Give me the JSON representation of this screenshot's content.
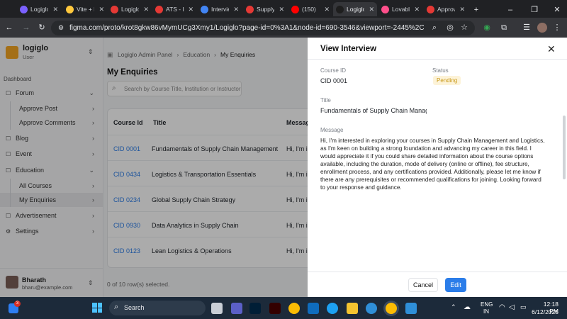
{
  "browser": {
    "tabs": [
      {
        "label": "Logiglo",
        "color": "#7b61ff"
      },
      {
        "label": "Vite + React",
        "color": "#ffc83d"
      },
      {
        "label": "Logiglo",
        "color": "#e53935"
      },
      {
        "label": "ATS - Logiglo",
        "color": "#e53935"
      },
      {
        "label": "Interview",
        "color": "#4285f4"
      },
      {
        "label": "Supply Chain",
        "color": "#e53935"
      },
      {
        "label": "(150)",
        "color": "#ff0000"
      },
      {
        "label": "Logiglo",
        "color": "#1e1e1e"
      },
      {
        "label": "Lovable",
        "color": "#ff4f8b"
      },
      {
        "label": "Approve",
        "color": "#e53935"
      }
    ],
    "url": "figma.com/proto/krot8gkw86vMymUCg3Xmy1/Logiglo?page-id=0%3A1&node-id=690-3546&viewport=-2445%2C-5346%2C0..."
  },
  "sidebar": {
    "brand": "logiglo",
    "brand_sub": "User",
    "section": "Dashboard",
    "items": [
      {
        "label": "Forum",
        "chev": "⌄"
      },
      {
        "label": "Approve Post",
        "chev": "›"
      },
      {
        "label": "Approve Comments",
        "chev": "›"
      },
      {
        "label": "Blog",
        "chev": "›"
      },
      {
        "label": "Event",
        "chev": "›"
      },
      {
        "label": "Education",
        "chev": "⌄"
      },
      {
        "label": "All Courses",
        "chev": "›"
      },
      {
        "label": "My Enquiries",
        "chev": "›"
      },
      {
        "label": "Advertisement",
        "chev": "›"
      },
      {
        "label": "Settings",
        "chev": "›"
      }
    ],
    "user_name": "Bharath",
    "user_email": "bharu@example.com"
  },
  "main": {
    "breadcrumb": [
      "Logiglo Admin Panel",
      "Education",
      "My Enquiries"
    ],
    "title": "My Enquiries",
    "search_placeholder": "Search by Course Title, Institution or Instructor",
    "columns": [
      "Course Id",
      "Title",
      "Message"
    ],
    "rows": [
      {
        "id": "CID 0001",
        "title": "Fundamentals of Supply Chain Management",
        "msg": "Hi, I'm in"
      },
      {
        "id": "CID 0434",
        "title": "Logistics & Transportation Essentials",
        "msg": "Hi, I'm in"
      },
      {
        "id": "CID 0234",
        "title": "Global Supply Chain Strategy",
        "msg": "Hi, I'm in"
      },
      {
        "id": "CID 0930",
        "title": "Data Analytics in Supply Chain",
        "msg": "Hi, I'm in"
      },
      {
        "id": "CID 0123",
        "title": "Lean Logistics & Operations",
        "msg": "Hi, I'm in"
      }
    ],
    "footer": "0 of 10 row(s) selected."
  },
  "modal": {
    "title": "View Interview",
    "course_id_label": "Course ID",
    "course_id": "CID 0001",
    "status_label": "Status",
    "status": "Pending",
    "title_label": "Title",
    "title_value": "Fundamentals of Supply Chain Managem",
    "message_label": "Message",
    "message": "Hi, I'm interested in exploring your courses in Supply Chain Management and Logistics, as I'm keen on building a strong foundation and advancing my career in this field. I would appreciate it if you could share detailed information about the course options available, including the duration, mode of delivery (online or offline), fee structure, enrollment process, and any certifications provided. Additionally, please let me know if there are any prerequisites or recommended qualifications for joining. Looking forward to your response and guidance.",
    "cancel": "Cancel",
    "edit": "Edit"
  },
  "taskbar": {
    "search": "Search",
    "lang": "ENG",
    "region": "IN",
    "time": "12:18 PM",
    "date": "6/12/2025",
    "badge": "3"
  },
  "colors": {
    "accent": "#2b7de9",
    "pending_bg": "#fdf3d8",
    "pending_fg": "#c99a1c",
    "brand": "#f5a623"
  }
}
